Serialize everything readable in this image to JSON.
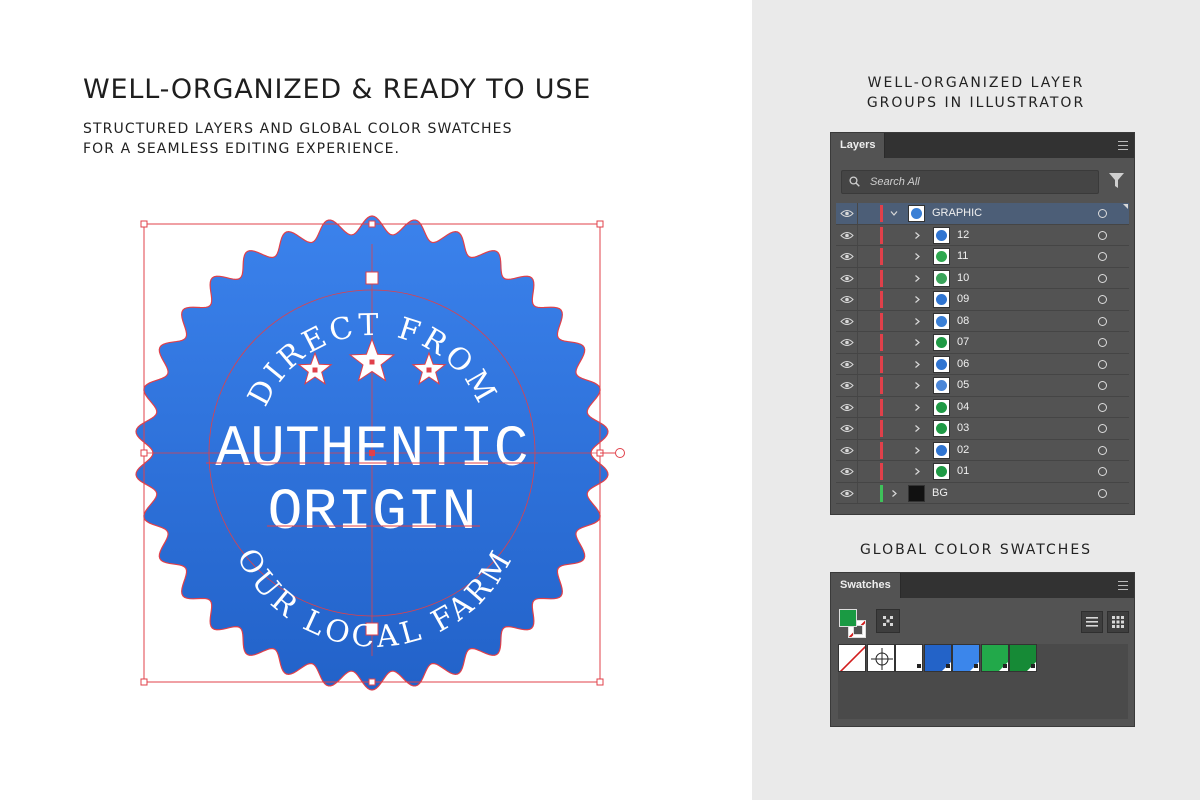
{
  "headline": "WELL-ORGANIZED & READY TO USE",
  "subtext": [
    "STRUCTURED LAYERS AND GLOBAL COLOR SWATCHES",
    "FOR A SEAMLESS EDITING EXPERIENCE."
  ],
  "layers_caption": [
    "WELL-ORGANIZED LAYER",
    "GROUPS IN ILLUSTRATOR"
  ],
  "swatches_caption": "GLOBAL COLOR SWATCHES",
  "badge": {
    "top_text": "DIRECT FROM",
    "main_line1": "AUTHENTIC",
    "main_line2": "ORIGIN",
    "bottom_text": "OUR LOCAL FARM",
    "colors": {
      "blue_top": "#3b82ec",
      "blue_bottom": "#2262c9",
      "selection": "#e0404a"
    }
  },
  "layers_panel": {
    "tab": "Layers",
    "search_placeholder": "Search All",
    "layers": [
      {
        "name": "GRAPHIC",
        "expanded": true,
        "selected": true,
        "color": "#e0404a",
        "thumb": "#3a7fd5"
      },
      {
        "name": "12",
        "color": "#e0404a",
        "thumb": "#2f74d1"
      },
      {
        "name": "11",
        "color": "#e0404a",
        "thumb": "#2ea84f"
      },
      {
        "name": "10",
        "color": "#e0404a",
        "thumb": "#3aa45a"
      },
      {
        "name": "09",
        "color": "#e0404a",
        "thumb": "#2f74d1"
      },
      {
        "name": "08",
        "color": "#e0404a",
        "thumb": "#3a7fd5"
      },
      {
        "name": "07",
        "color": "#e0404a",
        "thumb": "#1f9a45"
      },
      {
        "name": "06",
        "color": "#e0404a",
        "thumb": "#2f74d1"
      },
      {
        "name": "05",
        "color": "#e0404a",
        "thumb": "#4a86d8"
      },
      {
        "name": "04",
        "color": "#e0404a",
        "thumb": "#1f9a45"
      },
      {
        "name": "03",
        "color": "#e0404a",
        "thumb": "#1f9a45"
      },
      {
        "name": "02",
        "color": "#e0404a",
        "thumb": "#2f74d1"
      },
      {
        "name": "01",
        "color": "#e0404a",
        "thumb": "#1f9a45"
      },
      {
        "name": "BG",
        "color": "#3ec25a",
        "thumb": "#111111"
      }
    ]
  },
  "swatches_panel": {
    "tab": "Swatches",
    "swatches": [
      "none",
      "registration",
      "#ffffff",
      "#2363c8",
      "#3b86eb",
      "#22a94a",
      "#168a36"
    ]
  }
}
